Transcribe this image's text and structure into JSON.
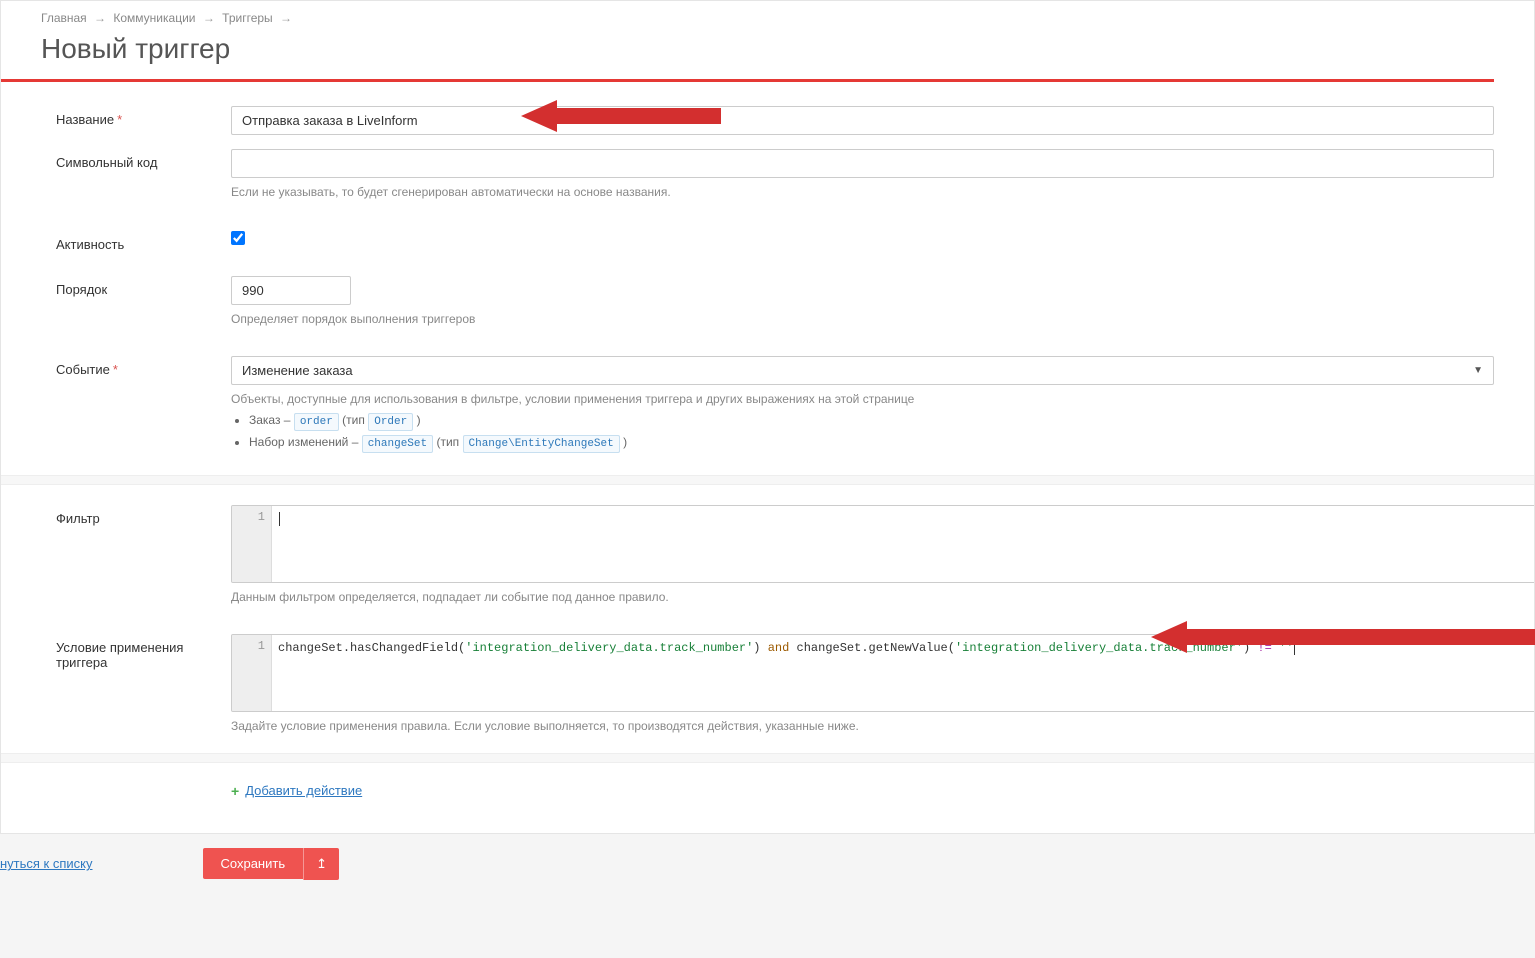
{
  "breadcrumb": {
    "home": "Главная",
    "communications": "Коммуникации",
    "triggers": "Триггеры"
  },
  "page_title": "Новый триггер",
  "labels": {
    "name": "Название",
    "symcode": "Символьный код",
    "activity": "Активность",
    "order": "Порядок",
    "event": "Событие",
    "filter": "Фильтр",
    "condition": "Условие применения триггера"
  },
  "fields": {
    "name_value": "Отправка заказа в LiveInform",
    "symcode_value": "",
    "symcode_help": "Если не указывать, то будет сгенерирован автоматически на основе названия.",
    "activity_checked": true,
    "order_value": "990",
    "order_help": "Определяет порядок выполнения триггеров",
    "event_value": "Изменение заказа",
    "event_help": "Объекты, доступные для использования в фильтре, условии применения триггера и других выражениях на этой странице"
  },
  "event_objects": {
    "line1_prefix": "Заказ – ",
    "line1_token1": "order",
    "line1_mid": " (тип ",
    "line1_token2": "Order",
    "line1_end": " )",
    "line2_prefix": "Набор изменений – ",
    "line2_token1": "changeSet",
    "line2_mid": " (тип ",
    "line2_token2": "Change\\EntityChangeSet",
    "line2_end": " )"
  },
  "filter": {
    "help": "Данным фильтром определяется, подпадает ли событие под данное правило."
  },
  "condition": {
    "code_tokens": {
      "part1a": "changeSet",
      "dot1": ".",
      "fn1": "hasChangedField",
      "open1": "(",
      "str1": "'integration_delivery_data.track_number'",
      "close1": ")",
      "space1": " ",
      "kw_and": "and",
      "space2": " ",
      "part2a": "changeSet",
      "dot2": ".",
      "fn2": "getNewValue",
      "open2": "(",
      "str2": "'integration_delivery_data.track_number'",
      "close2": ")",
      "space3": " ",
      "op_ne": "!=",
      "space4": " ",
      "empty": "''"
    },
    "help": "Задайте условие применения правила. Если условие выполняется, то производятся действия, указанные ниже."
  },
  "actions": {
    "add_label": "Добавить действие"
  },
  "footer": {
    "back_to_list": "нуться к списку",
    "save": "Сохранить"
  },
  "gutter": {
    "one": "1"
  }
}
